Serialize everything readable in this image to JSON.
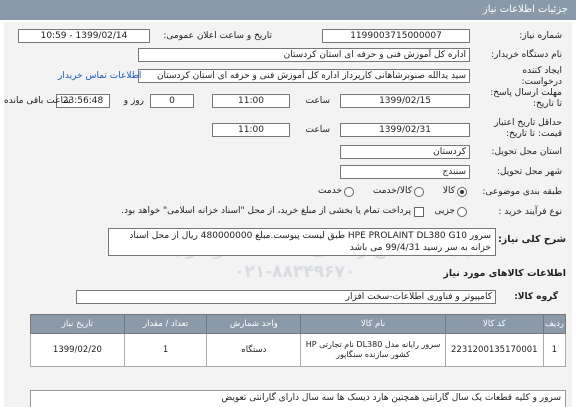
{
  "header": {
    "title": "جزئیات اطلاعات نیاز"
  },
  "form": {
    "need_number_label": "شماره نیاز:",
    "need_number": "1199003715000007",
    "announce_label": "تاریخ و ساعت اعلان عمومی:",
    "announce_value": "1399/02/14 - 10:59",
    "buyer_label": "نام دستگاه خریدار:",
    "buyer": "اداره کل آموزش فنی و حرفه ای استان کردستان",
    "creator_label_1": "ایجاد کننده",
    "creator_label_2": "درخواست:",
    "creator": "سید یدالله صنوبرشاهانی کارپرداز اداره کل آموزش فنی و حرفه ای استان کردستان",
    "contact_link": "اطلاعات تماس خریدار",
    "deadline_label_1": "مهلت ارسال پاسخ:",
    "deadline_label_2": "تا تاریخ:",
    "deadline_date": "1399/02/15",
    "time_label": "ساعت",
    "deadline_time": "11:00",
    "days": "0",
    "days_label": "روز و",
    "remaining_time": "23:56:48",
    "remaining_label": "ساعت باقی مانده",
    "validity_label_1": "حداقل تاریخ اعتبار",
    "validity_label_2": "قیمت: تا تاریخ:",
    "validity_date": "1399/02/31",
    "validity_time": "11:00",
    "province_label": "استان محل تحویل:",
    "province": "کردستان",
    "city_label": "شهر محل تحویل:",
    "city": "سنندج",
    "category_label": "طبقه بندی موضوعی:",
    "cat_goods": "کالا",
    "cat_service": "کالا/خدمت",
    "cat_other": "خدمت",
    "payment_label": "نوع فرآیند خرید :",
    "pay_partial": "جزیی",
    "pay_note": "پرداخت تمام یا بخشی از مبلغ خرید، از محل \"اسناد خزانه اسلامی\" خواهد بود."
  },
  "description": {
    "label": "شرح کلی نیاز:",
    "text": "سرور  HPE PROLAINT DL380 G10 طبق لیست پیوست.مبلغ 480000000 ریال از محل اسناد خزانه به سر رسید 99/4/31 می باشد"
  },
  "goods_section": {
    "title": "اطلاعات کالاهای مورد نیاز"
  },
  "goods_group": {
    "label": "گروه کالا:",
    "value": "کامپیوتر و فناوری اطلاعات-سخت افزار"
  },
  "table": {
    "headers": [
      "ردیف",
      "کد کالا",
      "نام کالا",
      "واحد شمارش",
      "تعداد / مقدار",
      "تاریخ نیاز"
    ],
    "rows": [
      [
        "1",
        "2231200135170001",
        "سرور رایانه مدل DL380 نام تجارتی HP کشور سازنده سنگاپور",
        "دستگاه",
        "1",
        "1399/02/20"
      ]
    ]
  },
  "notes": {
    "text": "سرور و کلیه قطعات یک سال گارانتی همچنین هارد دیسک ها سه سال دارای گارانتی تعویض"
  },
  "watermark": {
    "line1": "پایگاه اطلاع رسانی مناقصات و مزایده",
    "line2": "۰۲۱-۸۸۳۴۹۶۷۰"
  }
}
